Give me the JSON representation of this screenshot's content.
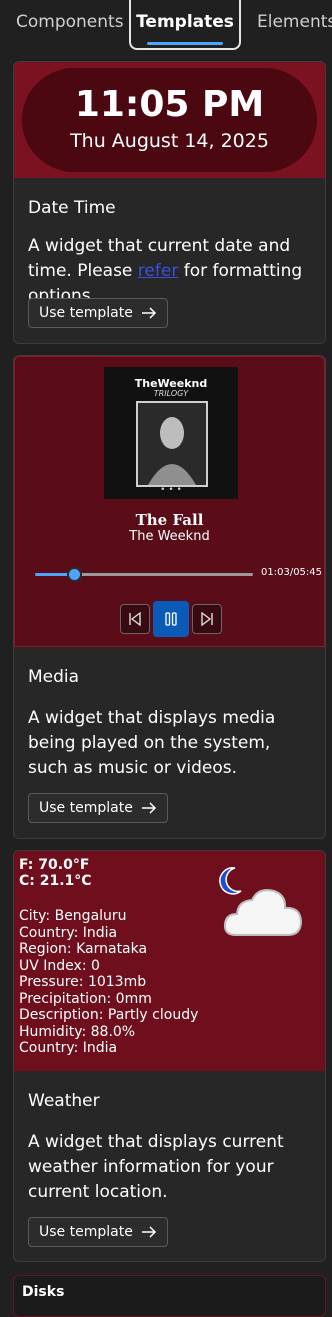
{
  "tabs": [
    {
      "label": "Components"
    },
    {
      "label": "Templates"
    },
    {
      "label": "Elements"
    }
  ],
  "datetime": {
    "time": "11:05 PM",
    "date": "Thu August 14, 2025",
    "title": "Date Time",
    "desc_before": "A widget that current date and time. Please ",
    "desc_link": "refer",
    "desc_after": " for formatting options.",
    "button": "Use template"
  },
  "media": {
    "album_artist": "TheWeeknd",
    "album_name": "TRILOGY",
    "album_dots": "• • •",
    "song": "The Fall",
    "artist": "The Weeknd",
    "timecode": "01:03/05:45",
    "progress": 0.18,
    "title": "Media",
    "desc": "A widget that displays media being played on the system, such as music or videos.",
    "button": "Use template"
  },
  "weather": {
    "temp_f": "F: 70.0°F",
    "temp_c": "C: 21.1°C",
    "lines": [
      "City: Bengaluru",
      "Country: India",
      "Region: Karnataka",
      "UV Index: 0",
      "Pressure: 1013mb",
      "Precipitation: 0mm",
      "Description: Partly cloudy",
      "Humidity: 88.0%",
      "Country: India"
    ],
    "title": "Weather",
    "desc": "A widget that displays current weather information for your current location.",
    "button": "Use template"
  },
  "disks": {
    "label": "Disks"
  },
  "colors": {
    "accent": "#4ea3ff",
    "play_button": "#0a5bb7",
    "card_bg": "#272727",
    "preview_red": "#7a1220"
  }
}
